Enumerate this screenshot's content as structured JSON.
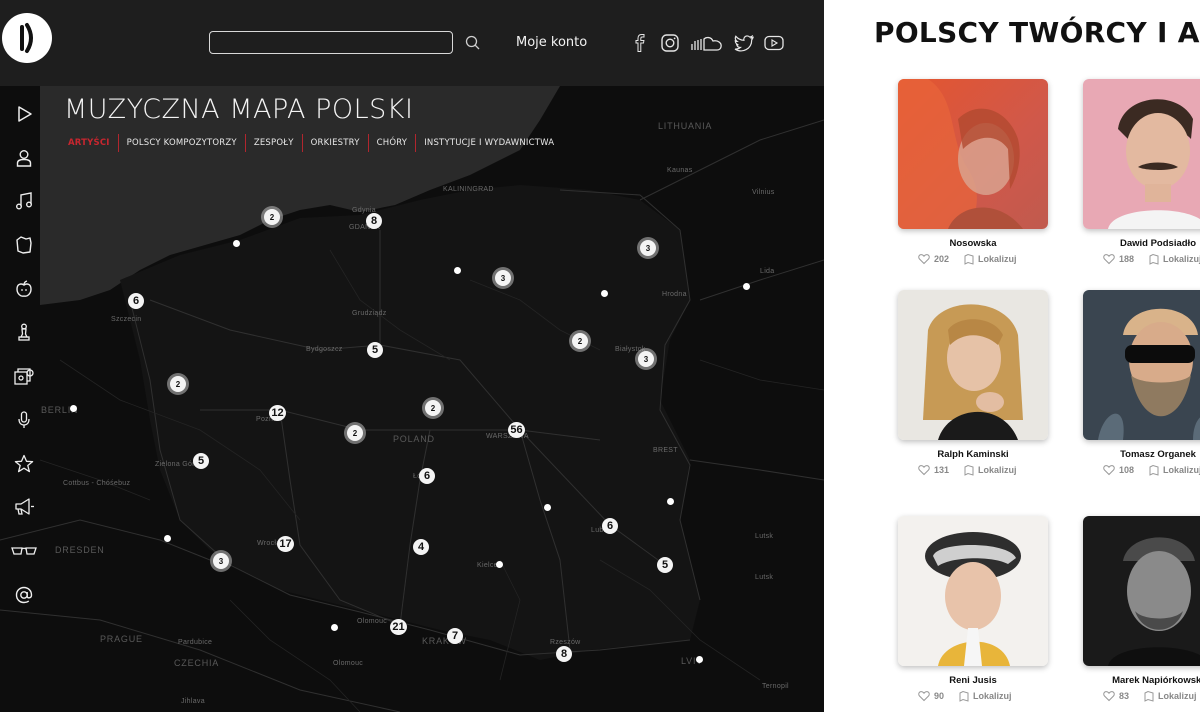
{
  "header": {
    "search_placeholder": "",
    "account_label": "Moje konto"
  },
  "map": {
    "title": "MUZYCZNA MAPA POLSKI",
    "tabs": [
      {
        "label": "ARTYŚCI"
      },
      {
        "label": "POLSCY KOMPOZYTORZY"
      },
      {
        "label": "ZESPOŁY"
      },
      {
        "label": "ORKIESTRY"
      },
      {
        "label": "CHÓRY"
      },
      {
        "label": "INSTYTUCJE I WYDAWNICTWA"
      }
    ],
    "active_tab": "ARTYŚCI",
    "labels": {
      "lithuania": "LITHUANIA",
      "kaliningrad": "KALININGRAD",
      "kaunas": "Kaunas",
      "vilnius": "Vilnius",
      "lida": "Lida",
      "hrodna": "Hrodna",
      "gdansk": "GDAŃSK",
      "gdynia": "Gdynia",
      "szczecin": "Szczecin",
      "grudziadz": "Grudziądz",
      "bydgoszcz": "Bydgoszcz",
      "bialystok": "Białystok",
      "berlin": "BERLIN",
      "poznan": "Poznań",
      "poland": "POLAND",
      "warsaw": "WARSZAWA",
      "brest": "BREST",
      "zielona_gora": "Zielona Góra",
      "cottbus": "Cottbus - Chóśebuz",
      "lodz": "Łódź",
      "lublin": "Lublin",
      "lutsk": "Lutsk",
      "dresden": "DRESDEN",
      "wroclaw": "Wrocław",
      "kielce": "Kielce",
      "prague": "PRAGUE",
      "pardubice": "Pardubice",
      "olomouc": "Olomouc",
      "krakow": "KRAKÓW",
      "rzeszow": "Rzeszów",
      "lviv": "LVIV",
      "ternopil": "Ternopil",
      "czechia": "CZECHIA",
      "jihlava": "Jihlava"
    },
    "clusters": [
      "2",
      "8",
      "3",
      "3",
      "6",
      "5",
      "2",
      "3",
      "2",
      "12",
      "2",
      "2",
      "56",
      "5",
      "6",
      "6",
      "17",
      "3",
      "4",
      "5",
      "21",
      "7",
      "8"
    ]
  },
  "social_icons": [
    "facebook-icon",
    "instagram-icon",
    "soundcloud-icon",
    "twitter-icon",
    "youtube-icon"
  ],
  "nav_icons": [
    "play-icon",
    "person-icon",
    "music-note-icon",
    "map-region-icon",
    "apple-icon",
    "chess-pawn-icon",
    "albums-icon",
    "microphone-icon",
    "star-icon",
    "megaphone-icon",
    "glasses-icon",
    "at-sign-icon"
  ],
  "artists": {
    "heading": "POLSCY TWÓRCY I ARTYŚCI",
    "locate_label": "Lokalizuj",
    "items": [
      {
        "name": "Nosowska",
        "likes": "202"
      },
      {
        "name": "Dawid Podsiadło",
        "likes": "188"
      },
      {
        "name": "Ralph Kaminski",
        "likes": "131"
      },
      {
        "name": "Tomasz Organek",
        "likes": "108"
      },
      {
        "name": "Reni Jusis",
        "likes": "90"
      },
      {
        "name": "Marek Napiórkowski",
        "likes": "83"
      }
    ]
  },
  "colors": {
    "accent_red": "#c8262f",
    "topbar": "#1e1e1e",
    "map_bg": "#0d0d0d"
  }
}
